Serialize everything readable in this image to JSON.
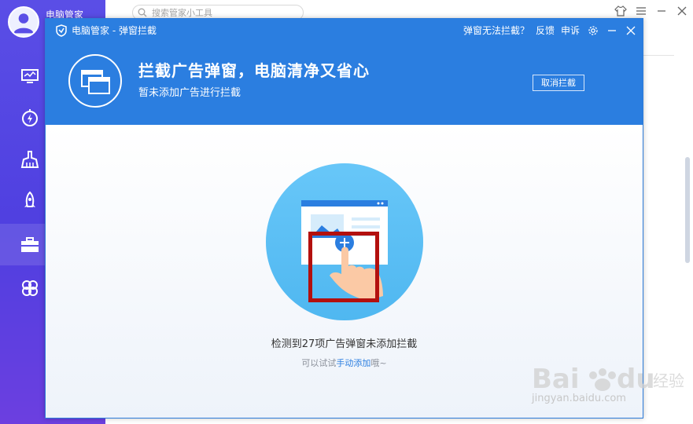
{
  "app": {
    "name": "电脑管家"
  },
  "search": {
    "placeholder": "搜索管家小工具"
  },
  "sidebar": {
    "items": [
      {
        "name": "monitor"
      },
      {
        "name": "speed"
      },
      {
        "name": "clean"
      },
      {
        "name": "rocket"
      },
      {
        "name": "toolbox",
        "active": true
      },
      {
        "name": "apps"
      }
    ]
  },
  "dialog": {
    "title": "电脑管家 - 弹窗拦截",
    "actions": {
      "cannot_block": "弹窗无法拦截？",
      "feedback": "反馈",
      "complain": "申诉"
    },
    "hero": {
      "title": "拦截广告弹窗，电脑清净又省心",
      "subtitle": "暂未添加广告进行拦截",
      "cancel_label": "取消拦截"
    },
    "body": {
      "message": "检测到27项广告弹窗未添加拦截",
      "hint_prefix": "可以试试",
      "hint_link": "手动添加",
      "hint_suffix": "哦~"
    }
  },
  "watermark": {
    "text": "jingyan.baidu.com"
  },
  "colors": {
    "brand_blue": "#2b7ee0",
    "sidebar_purple": "#5a4ee6",
    "highlight_red": "#b3100e"
  }
}
